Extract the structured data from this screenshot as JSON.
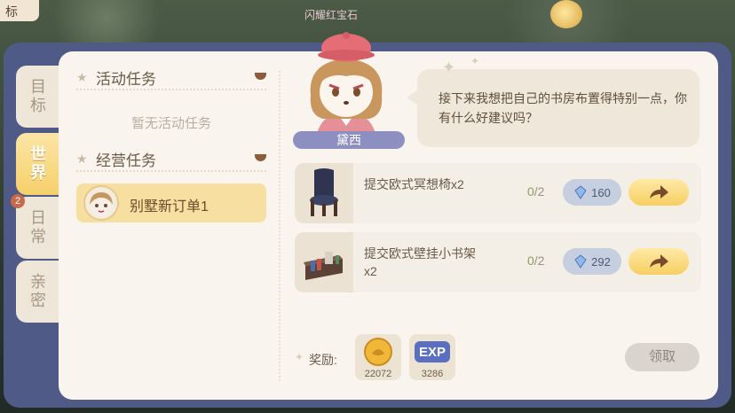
{
  "background": {
    "corner_label": "标",
    "banner_text": "闪耀红宝石"
  },
  "tabs": [
    {
      "label": "目标",
      "active": false
    },
    {
      "label": "世界",
      "active": true
    },
    {
      "label": "日常",
      "active": false,
      "badge": "2"
    },
    {
      "label": "亲密",
      "active": false
    }
  ],
  "task_list": {
    "activity_header": "活动任务",
    "activity_empty": "暂无活动任务",
    "business_header": "经营任务",
    "business_items": [
      {
        "label": "别墅新订单1"
      }
    ]
  },
  "character": {
    "name": "黛西",
    "dialogue": "接下来我想把自己的书房布置得特别一点，你有什么好建议吗？"
  },
  "quests": [
    {
      "name": "提交欧式冥想椅x2",
      "progress": "0",
      "required": "/2",
      "gem_reward": "160",
      "icon": "chair-icon"
    },
    {
      "name": "提交欧式壁挂小书架x2",
      "progress": "0",
      "required": "/2",
      "gem_reward": "292",
      "icon": "bookshelf-icon"
    }
  ],
  "rewards": {
    "label": "奖励:",
    "items": [
      {
        "icon": "coin-icon",
        "amount": "22072"
      },
      {
        "icon": "exp-icon",
        "amount": "3286",
        "text": "EXP"
      }
    ]
  },
  "claim_button": "领取",
  "colors": {
    "accent_yellow": "#f6cf62",
    "frame": "#4f5b86",
    "panel": "#f9f5ee",
    "progress_green": "#8aa05d"
  }
}
